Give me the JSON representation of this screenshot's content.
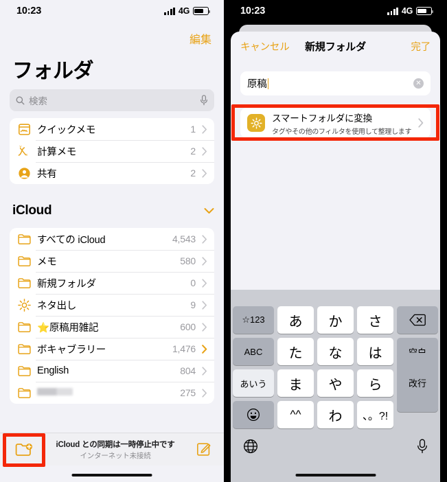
{
  "left": {
    "status": {
      "clock": "10:23",
      "network": "4G",
      "signal_bars": 4,
      "battery_icon": "battery-icon"
    },
    "edit_label": "編集",
    "title": "フォルダ",
    "search": {
      "placeholder": "検索",
      "icon": "search-icon",
      "mic_icon": "microphone-icon"
    },
    "top_list": [
      {
        "icon": "quick-note-icon",
        "label": "クイックメモ",
        "count": "1",
        "chevron_active": false
      },
      {
        "icon": "math-notes-icon",
        "label": "計算メモ",
        "count": "2",
        "chevron_active": false
      },
      {
        "icon": "shared-person-icon",
        "label": "共有",
        "count": "2",
        "chevron_active": false
      }
    ],
    "section": {
      "title": "iCloud",
      "chevron": "chevron-down-icon"
    },
    "icloud_list": [
      {
        "icon": "folder-icon",
        "label": "すべての iCloud",
        "count": "4,543",
        "chevron_active": false
      },
      {
        "icon": "folder-icon",
        "label": "メモ",
        "count": "580",
        "chevron_active": false
      },
      {
        "icon": "folder-icon",
        "label": "新規フォルダ",
        "count": "0",
        "chevron_active": false
      },
      {
        "icon": "gear-icon",
        "label": "ネタ出し",
        "count": "9",
        "chevron_active": false
      },
      {
        "icon": "folder-icon",
        "label": "⭐原稿用雑記",
        "count": "600",
        "chevron_active": false
      },
      {
        "icon": "folder-icon",
        "label": "ボキャブラリー",
        "count": "1,476",
        "chevron_active": true
      },
      {
        "icon": "folder-icon",
        "label": "English",
        "count": "804",
        "chevron_active": false
      },
      {
        "icon": "folder-icon",
        "label": "",
        "redacted": true,
        "count": "275",
        "chevron_active": false
      }
    ],
    "toolbar": {
      "new_folder_icon": "new-folder-icon",
      "status_line1": "iCloud との同期は一時停止中です",
      "status_line2": "インターネット未接続",
      "compose_icon": "compose-icon"
    }
  },
  "right": {
    "status": {
      "clock": "10:23",
      "network": "4G",
      "signal_bars": 4,
      "battery_icon": "battery-icon"
    },
    "nav": {
      "cancel": "キャンセル",
      "title": "新規フォルダ",
      "done": "完了"
    },
    "name_field": {
      "value": "原稿",
      "clear_icon": "clear-text-icon"
    },
    "smart_row": {
      "icon": "gear-icon",
      "title": "スマートフォルダに変換",
      "subtitle": "タグやその他のフィルタを使用して整理します",
      "chevron": "chevron-right-icon"
    },
    "keyboard": {
      "rows": [
        [
          {
            "label": "☆123",
            "type": "fn"
          },
          {
            "label": "あ",
            "type": "char"
          },
          {
            "label": "か",
            "type": "char"
          },
          {
            "label": "さ",
            "type": "char"
          },
          {
            "label": "delete-icon",
            "type": "fn-icon"
          }
        ],
        [
          {
            "label": "ABC",
            "type": "fn"
          },
          {
            "label": "た",
            "type": "char"
          },
          {
            "label": "な",
            "type": "char"
          },
          {
            "label": "は",
            "type": "char"
          },
          {
            "label": "空白",
            "type": "fn"
          }
        ],
        [
          {
            "label": "あいう",
            "type": "fn-light"
          },
          {
            "label": "ま",
            "type": "char"
          },
          {
            "label": "や",
            "type": "char"
          },
          {
            "label": "ら",
            "type": "char"
          }
        ],
        [
          {
            "label": "emoji-icon",
            "type": "fn-icon"
          },
          {
            "label": "^^",
            "type": "char"
          },
          {
            "label": "わ",
            "type": "char"
          },
          {
            "label": "、。?!",
            "type": "char"
          }
        ]
      ],
      "return_key": "改行",
      "globe_icon": "globe-icon",
      "dictation_icon": "microphone-icon"
    }
  },
  "colors": {
    "accent": "#e8a317",
    "highlight_box": "#f42708",
    "panel_bg": "#f2f2f7",
    "keyboard_bg": "#cbcdd3",
    "smart_icon_bg": "#e2b128"
  }
}
